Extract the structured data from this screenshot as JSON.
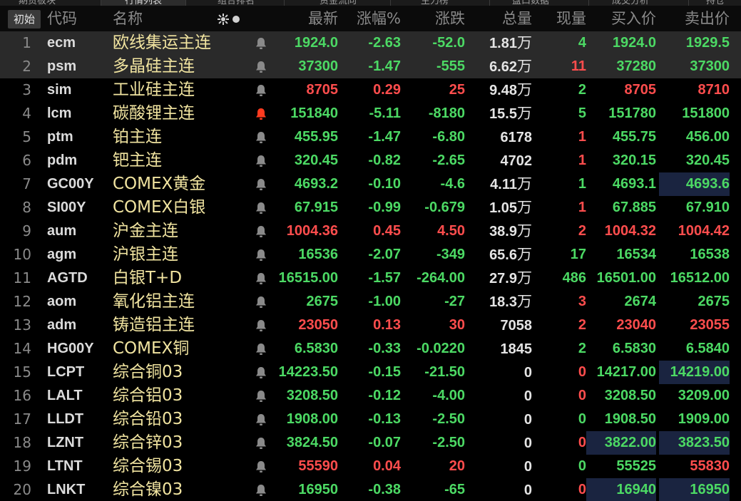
{
  "tabs": [
    "期货板块",
    "行情列表",
    "组合排名",
    "资金流向",
    "主力榜",
    "盘口数据",
    "成交分析",
    "持仓"
  ],
  "header": {
    "reset_label": "初始",
    "columns": {
      "code": "代码",
      "name": "名称",
      "last": "最新",
      "pct": "涨幅%",
      "chg": "涨跌",
      "vol": "总量",
      "curvol": "现量",
      "bid": "买入价",
      "ask": "卖出价"
    }
  },
  "colors": {
    "up": "#ff4d4d",
    "down": "#4cd964",
    "name": "#f1e4a0",
    "bell_active": "#ff3b1f",
    "bell": "#8a8a8a"
  },
  "rows": [
    {
      "idx": "1",
      "code": "ecm",
      "name": "欧线集运主连",
      "bell": "bell-icon",
      "last": "1924.0",
      "pct": "-2.63",
      "chg": "-52.0",
      "vol": "1.81",
      "vol_unit": "万",
      "curvol": "4",
      "bid": "1924.0",
      "ask": "1929.5",
      "dir": "dn",
      "curvol_dir": "dn",
      "selected": true
    },
    {
      "idx": "2",
      "code": "psm",
      "name": "多晶硅主连",
      "bell": "bell-icon",
      "last": "37300",
      "pct": "-1.47",
      "chg": "-555",
      "vol": "6.62",
      "vol_unit": "万",
      "curvol": "11",
      "bid": "37280",
      "ask": "37300",
      "dir": "dn",
      "curvol_dir": "up",
      "selected": true
    },
    {
      "idx": "3",
      "code": "sim",
      "name": "工业硅主连",
      "bell": "bell-icon",
      "last": "8705",
      "pct": "0.29",
      "chg": "25",
      "vol": "9.48",
      "vol_unit": "万",
      "curvol": "2",
      "bid": "8705",
      "ask": "8710",
      "dir": "up",
      "curvol_dir": "dn"
    },
    {
      "idx": "4",
      "code": "lcm",
      "name": "碳酸锂主连",
      "bell": "bell-active-icon",
      "last": "151840",
      "pct": "-5.11",
      "chg": "-8180",
      "vol": "15.5",
      "vol_unit": "万",
      "curvol": "5",
      "bid": "151780",
      "ask": "151800",
      "dir": "dn",
      "curvol_dir": "dn"
    },
    {
      "idx": "5",
      "code": "ptm",
      "name": "铂主连",
      "bell": "bell-icon",
      "last": "455.95",
      "pct": "-1.47",
      "chg": "-6.80",
      "vol": "6178",
      "vol_unit": "",
      "curvol": "1",
      "bid": "455.75",
      "ask": "456.00",
      "dir": "dn",
      "curvol_dir": "up"
    },
    {
      "idx": "6",
      "code": "pdm",
      "name": "钯主连",
      "bell": "bell-icon",
      "last": "320.45",
      "pct": "-0.82",
      "chg": "-2.65",
      "vol": "4702",
      "vol_unit": "",
      "curvol": "1",
      "bid": "320.15",
      "ask": "320.45",
      "dir": "dn",
      "curvol_dir": "up"
    },
    {
      "idx": "7",
      "code": "GC00Y",
      "name": "COMEX黄金",
      "bell": "bell-icon",
      "last": "4693.2",
      "pct": "-0.10",
      "chg": "-4.6",
      "vol": "4.11",
      "vol_unit": "万",
      "curvol": "1",
      "bid": "4693.1",
      "ask": "4693.6",
      "dir": "dn",
      "curvol_dir": "dn",
      "ask_hl": true
    },
    {
      "idx": "8",
      "code": "SI00Y",
      "name": "COMEX白银",
      "bell": "bell-icon",
      "last": "67.915",
      "pct": "-0.99",
      "chg": "-0.679",
      "vol": "1.05",
      "vol_unit": "万",
      "curvol": "1",
      "bid": "67.885",
      "ask": "67.910",
      "dir": "dn",
      "curvol_dir": "up"
    },
    {
      "idx": "9",
      "code": "aum",
      "name": "沪金主连",
      "bell": "bell-icon",
      "last": "1004.36",
      "pct": "0.45",
      "chg": "4.50",
      "vol": "38.9",
      "vol_unit": "万",
      "curvol": "2",
      "bid": "1004.32",
      "ask": "1004.42",
      "dir": "up",
      "curvol_dir": "up"
    },
    {
      "idx": "10",
      "code": "agm",
      "name": "沪银主连",
      "bell": "bell-icon",
      "last": "16536",
      "pct": "-2.07",
      "chg": "-349",
      "vol": "65.6",
      "vol_unit": "万",
      "curvol": "17",
      "bid": "16534",
      "ask": "16538",
      "dir": "dn",
      "curvol_dir": "dn"
    },
    {
      "idx": "11",
      "code": "AGTD",
      "name": "白银T+D",
      "bell": "bell-icon",
      "last": "16515.00",
      "pct": "-1.57",
      "chg": "-264.00",
      "vol": "27.9",
      "vol_unit": "万",
      "curvol": "486",
      "bid": "16501.00",
      "ask": "16512.00",
      "dir": "dn",
      "curvol_dir": "dn"
    },
    {
      "idx": "12",
      "code": "aom",
      "name": "氧化铝主连",
      "bell": "bell-icon",
      "last": "2675",
      "pct": "-1.00",
      "chg": "-27",
      "vol": "18.3",
      "vol_unit": "万",
      "curvol": "3",
      "bid": "2674",
      "ask": "2675",
      "dir": "dn",
      "curvol_dir": "up"
    },
    {
      "idx": "13",
      "code": "adm",
      "name": "铸造铝主连",
      "bell": "bell-icon",
      "last": "23050",
      "pct": "0.13",
      "chg": "30",
      "vol": "7058",
      "vol_unit": "",
      "curvol": "2",
      "bid": "23040",
      "ask": "23055",
      "dir": "up",
      "curvol_dir": "up"
    },
    {
      "idx": "14",
      "code": "HG00Y",
      "name": "COMEX铜",
      "bell": "bell-icon",
      "last": "6.5830",
      "pct": "-0.33",
      "chg": "-0.0220",
      "vol": "1845",
      "vol_unit": "",
      "curvol": "2",
      "bid": "6.5830",
      "ask": "6.5840",
      "dir": "dn",
      "curvol_dir": "dn"
    },
    {
      "idx": "15",
      "code": "LCPT",
      "name": "综合铜03",
      "bell": "bell-icon",
      "last": "14223.50",
      "pct": "-0.15",
      "chg": "-21.50",
      "vol": "0",
      "vol_unit": "",
      "curvol": "0",
      "bid": "14217.00",
      "ask": "14219.00",
      "dir": "dn",
      "curvol_dir": "up",
      "ask_hl": true
    },
    {
      "idx": "16",
      "code": "LALT",
      "name": "综合铝03",
      "bell": "bell-icon",
      "last": "3208.50",
      "pct": "-0.12",
      "chg": "-4.00",
      "vol": "0",
      "vol_unit": "",
      "curvol": "0",
      "bid": "3208.50",
      "ask": "3209.00",
      "dir": "dn",
      "curvol_dir": "up"
    },
    {
      "idx": "17",
      "code": "LLDT",
      "name": "综合铅03",
      "bell": "bell-icon",
      "last": "1908.00",
      "pct": "-0.13",
      "chg": "-2.50",
      "vol": "0",
      "vol_unit": "",
      "curvol": "0",
      "bid": "1908.50",
      "ask": "1909.00",
      "dir": "dn",
      "curvol_dir": "dn"
    },
    {
      "idx": "18",
      "code": "LZNT",
      "name": "综合锌03",
      "bell": "bell-icon",
      "last": "3824.50",
      "pct": "-0.07",
      "chg": "-2.50",
      "vol": "0",
      "vol_unit": "",
      "curvol": "0",
      "bid": "3822.00",
      "ask": "3823.50",
      "dir": "dn",
      "curvol_dir": "up",
      "bid_hl": true,
      "ask_hl": true
    },
    {
      "idx": "19",
      "code": "LTNT",
      "name": "综合锡03",
      "bell": "bell-icon",
      "last": "55590",
      "pct": "0.04",
      "chg": "20",
      "vol": "0",
      "vol_unit": "",
      "curvol": "0",
      "bid": "55525",
      "ask": "55830",
      "dir": "up",
      "curvol_dir": "dn",
      "bid_dir": "dn"
    },
    {
      "idx": "20",
      "code": "LNKT",
      "name": "综合镍03",
      "bell": "bell-icon",
      "last": "16950",
      "pct": "-0.38",
      "chg": "-65",
      "vol": "0",
      "vol_unit": "",
      "curvol": "0",
      "bid": "16940",
      "ask": "16950",
      "dir": "dn",
      "curvol_dir": "up",
      "bid_hl": true,
      "ask_hl": true
    }
  ]
}
